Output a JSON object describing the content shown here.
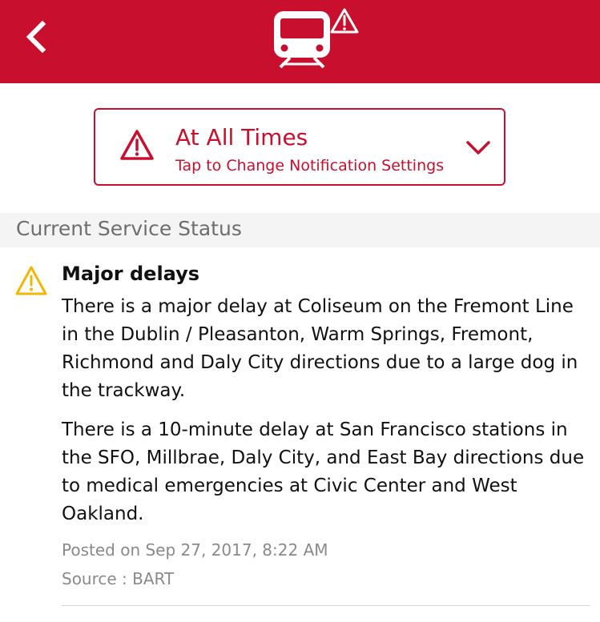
{
  "colors": {
    "brand": "#c8102e",
    "warning": "#f2b705",
    "section_bg": "#f4f4f4",
    "muted_text": "#8a8a8a"
  },
  "header": {
    "back_icon": "chevron-left-icon",
    "center_icon": "train-alert-icon"
  },
  "notification_setting": {
    "icon": "warning-icon",
    "title": "At All Times",
    "subtitle": "Tap to Change Notification Settings",
    "dropdown_icon": "chevron-down-icon"
  },
  "section": {
    "title": "Current Service Status"
  },
  "status": {
    "icon": "warning-icon",
    "title": "Major delays",
    "paragraphs": [
      "There is a major delay at Coliseum on the Fremont Line in the Dublin / Pleasanton, Warm Springs, Fremont, Richmond and Daly City directions due to a large dog in the trackway.",
      "There is a 10-minute delay at San Francisco stations in the SFO, Millbrae, Daly City, and East Bay directions due to medical emergencies at Civic Center and West Oakland."
    ],
    "posted": "Posted on Sep 27, 2017, 8:22 AM",
    "source": "Source : BART"
  }
}
